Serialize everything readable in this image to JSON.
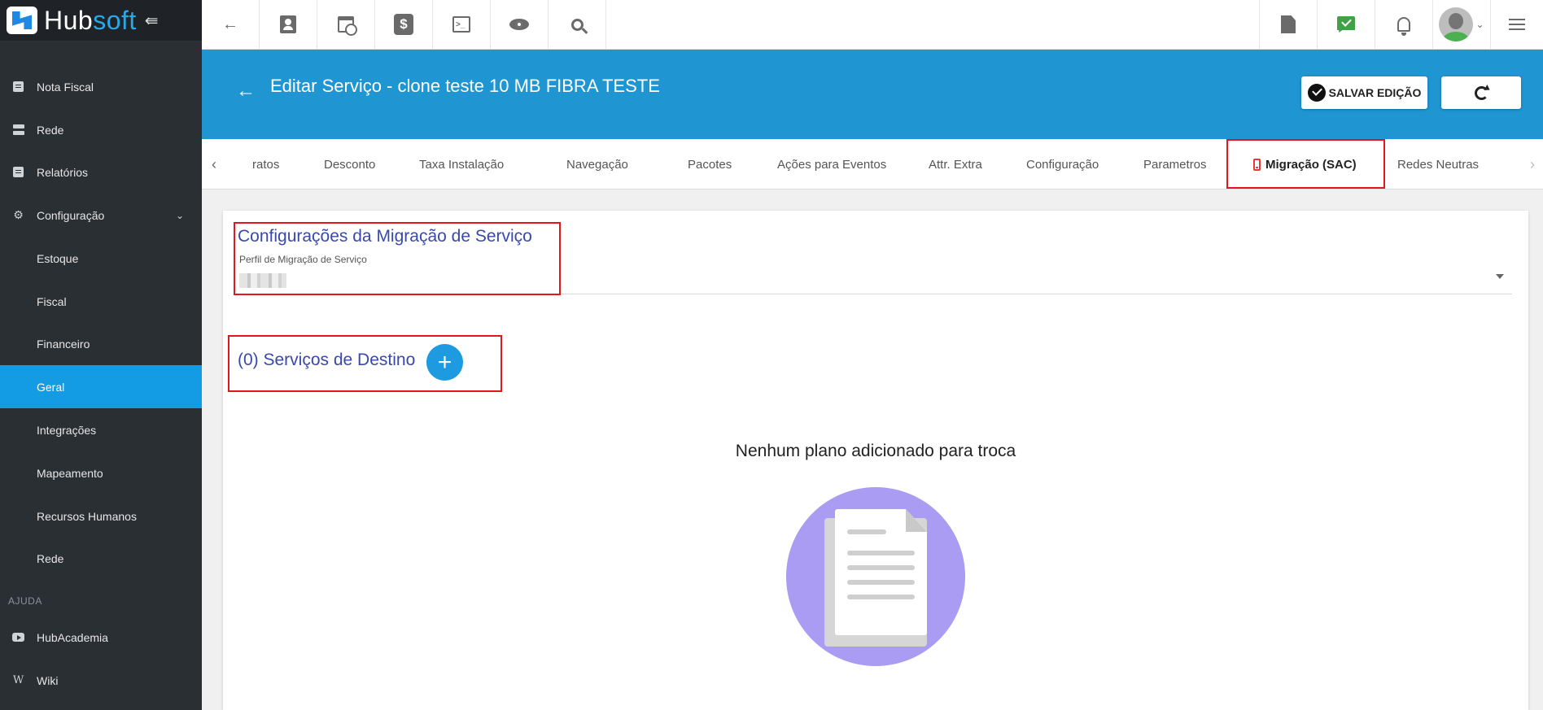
{
  "brand": {
    "name_part1": "Hub",
    "name_part2": "soft"
  },
  "sidebar": {
    "items": [
      {
        "label": "Nota Fiscal",
        "icon": "document-icon"
      },
      {
        "label": "Rede",
        "icon": "server-icon"
      },
      {
        "label": "Relatórios",
        "icon": "report-icon"
      },
      {
        "label": "Configuração",
        "icon": "gear-icon",
        "expanded": true
      },
      {
        "label": "Estoque"
      },
      {
        "label": "Fiscal"
      },
      {
        "label": "Financeiro"
      },
      {
        "label": "Geral",
        "active": true
      },
      {
        "label": "Integrações"
      },
      {
        "label": "Mapeamento"
      },
      {
        "label": "Recursos Humanos"
      },
      {
        "label": "Rede"
      }
    ],
    "section_label": "AJUDA",
    "help_items": [
      {
        "label": "HubAcademia",
        "icon": "youtube-icon"
      },
      {
        "label": "Wiki",
        "icon": "wikipedia-icon"
      }
    ]
  },
  "topbar": {
    "icons": [
      "back-arrow-icon",
      "contact-icon",
      "calendar-clock-icon",
      "dollar-icon",
      "terminal-icon",
      "eye-icon",
      "search-icon"
    ],
    "right_icons": [
      "pdf-icon",
      "chat-check-icon",
      "bell-icon",
      "avatar",
      "menu-list-icon"
    ],
    "dollar_glyph": "$",
    "terminal_glyph": ">_",
    "wiki_glyph": "W"
  },
  "header": {
    "title": "Editar Serviço - clone teste 10 MB FIBRA TESTE",
    "save_label": "SALVAR EDIÇÃO"
  },
  "tabs": [
    {
      "label": "ratos"
    },
    {
      "label": "Desconto"
    },
    {
      "label": "Taxa Instalação"
    },
    {
      "label": "Navegação"
    },
    {
      "label": "Pacotes"
    },
    {
      "label": "Ações para Eventos"
    },
    {
      "label": "Attr. Extra"
    },
    {
      "label": "Configuração"
    },
    {
      "label": "Parametros"
    },
    {
      "label": "Migração (SAC)",
      "active": true
    },
    {
      "label": "Redes Neutras"
    }
  ],
  "migration": {
    "section_title": "Configurações da Migração de Serviço",
    "profile_label": "Perfil de Migração de Serviço",
    "destinations_title": "(0) Serviços de Destino",
    "add_glyph": "+",
    "empty_message": "Nenhum plano adicionado para troca"
  },
  "colors": {
    "sidebar_bg": "#2a2f34",
    "accent": "#139be4",
    "header_bg": "#1f95d2",
    "section_title": "#3949ab",
    "highlight": "#e3161b",
    "empty_circle": "#a99cf2"
  }
}
